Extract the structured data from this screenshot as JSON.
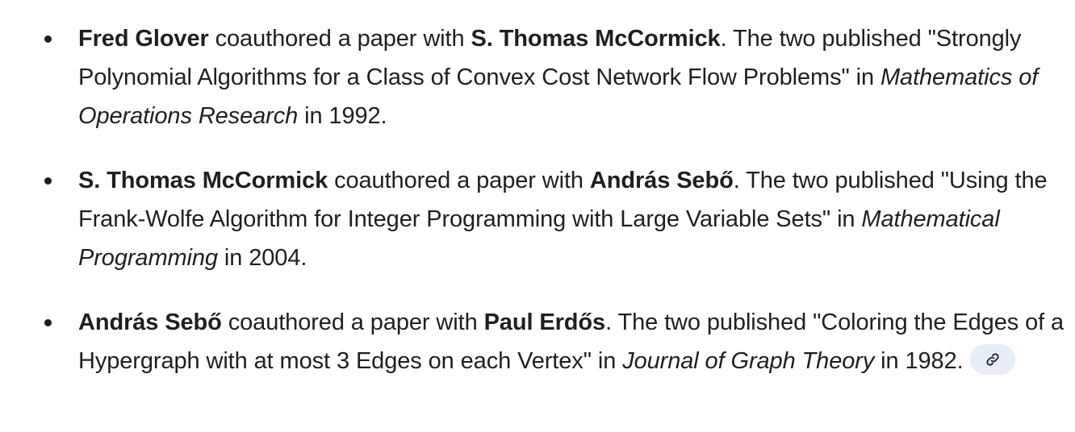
{
  "items": [
    {
      "author1": "Fred Glover",
      "t1": " coauthored a paper with ",
      "author2": "S. Thomas McCormick",
      "t2": ". The two published \"Strongly Polynomial Algorithms for a Class of Convex Cost Network Flow Problems\" in ",
      "venue": "Mathematics of Operations Research",
      "t3": " in 1992."
    },
    {
      "author1": "S. Thomas McCormick",
      "t1": " coauthored a paper with ",
      "author2": "András Sebő",
      "t2": ". The two published \"Using the Frank-Wolfe Algorithm for Integer Programming with Large Variable Sets\" in ",
      "venue": "Mathematical Programming",
      "t3": " in 2004."
    },
    {
      "author1": "András Sebő",
      "t1": " coauthored a paper with ",
      "author2": "Paul Erdős",
      "t2": ". The two published \"Coloring the Edges of a Hypergraph with at most 3 Edges on each Vertex\" in ",
      "venue": "Journal of Graph Theory",
      "t3": " in 1982."
    }
  ],
  "source_link": {
    "icon": "link-icon"
  }
}
